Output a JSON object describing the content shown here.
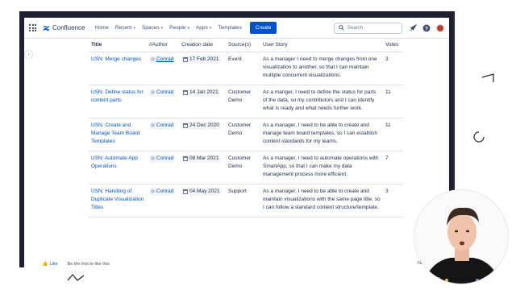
{
  "nav": {
    "logo": "Confluence",
    "items": [
      "Home",
      "Recent",
      "Spaces",
      "People",
      "Apps",
      "Templates"
    ],
    "dropdown_items": [
      false,
      true,
      true,
      true,
      true,
      false
    ],
    "create_label": "Create",
    "search_placeholder": "Search"
  },
  "table": {
    "headers": [
      "Title",
      "//Author",
      "Creation date",
      "Source(s)",
      "User Story",
      "Votes"
    ],
    "rows": [
      {
        "title": "USN: Merge changes",
        "author": "Conrad",
        "date": "17 Feb 2021",
        "source": "Event",
        "story": "As a manager I need to merge changes from one visualization to another, so that I can maintain multiple concurrent visualizations.",
        "votes": "3"
      },
      {
        "title": "USN: Define status for content parts",
        "author": "Conrad",
        "date": "14 Jan 2021",
        "source": "Customer Demo",
        "story": "As a manger, I need to define the status for parts of the data, so my contributors and I can identify what is ready and what needs further work.",
        "votes": "11"
      },
      {
        "title": "USN: Create and Manage Team Board Templates",
        "author": "Conrad",
        "date": "24 Dec 2020",
        "source": "Customer Demo",
        "story": "As a manager, I need to be able to create and manage team board templates, so I can establish content standards for my teams.",
        "votes": "11"
      },
      {
        "title": "USN: Automate App Operations",
        "author": "Conrad",
        "date": "08 Mar 2021",
        "source": "Customer Demo",
        "story": "As a manager, I need to automate operations with SmartApp, so that I can make my data management process more efficient.",
        "votes": "7"
      },
      {
        "title": "USN: Handling of Duplicate Visualization Titles",
        "author": "Conrad",
        "date": "04 May 2021",
        "source": "Support",
        "story": "As a manager, I need to be able to create and maintain visualizations with the same page title, so I can follow a standard content structure/template.",
        "votes": "3"
      }
    ]
  },
  "footer": {
    "like_label": "Like",
    "be_first": "Be the first to like this",
    "next_partial": "No"
  },
  "colors": {
    "accent": "#0052cc",
    "frame_shadow": "#1d2133"
  }
}
